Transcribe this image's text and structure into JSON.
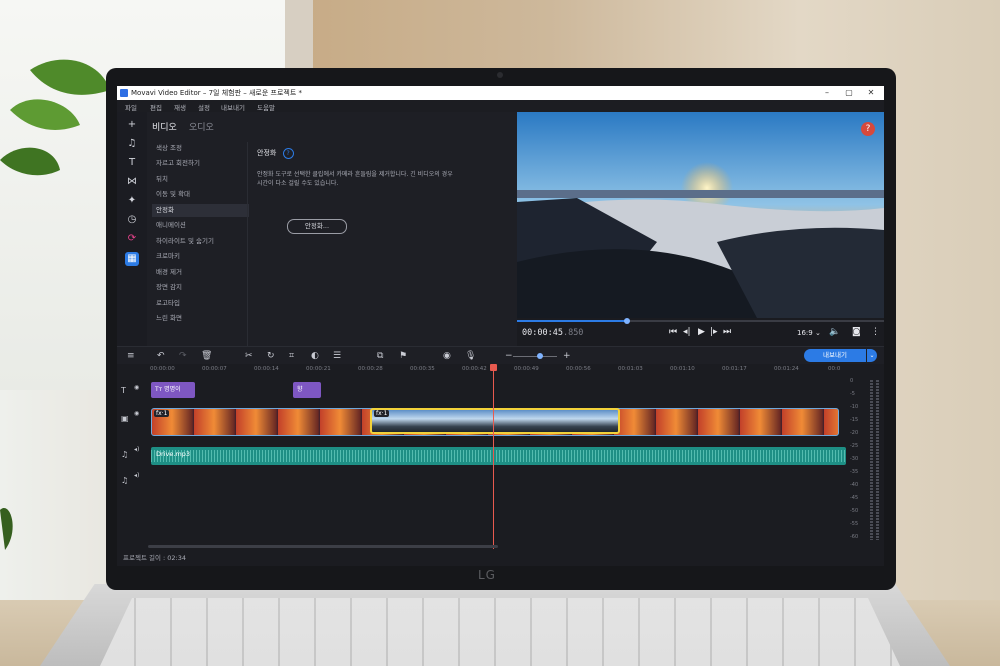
{
  "window": {
    "title": "Movavi Video Editor – 7일 체험판 – 새로운 프로젝트 *"
  },
  "menu": [
    "파일",
    "편집",
    "재생",
    "설정",
    "내보내기",
    "도움말"
  ],
  "panel_tabs": {
    "video": "비디오",
    "audio": "오디오"
  },
  "tools_list": [
    "색상 조정",
    "자르고 회전하기",
    "뒤치",
    "이동 및 확대",
    "안정화",
    "애니메이션",
    "하이라이트 및 숨기기",
    "크로마키",
    "배경 제거",
    "장면 감지",
    "로고타입",
    "느린 화면"
  ],
  "selected_tool_index": 4,
  "stabilization": {
    "heading": "안정화",
    "description_line1": "안정화 도구로 선택한 클립에서 카메라 흔들림을 제거합니다. 긴 비디오의 경우",
    "description_line2": "시간이 다소 걸릴 수도 있습니다.",
    "button": "안정화..."
  },
  "player": {
    "time": "00:00:45",
    "time_ms": ".850",
    "aspect": "16:9",
    "progress": 0.3
  },
  "toolbar": {
    "export_label": "내보내기"
  },
  "timeline": {
    "ruler": [
      "00:00:00",
      "00:00:07",
      "00:00:14",
      "00:00:21",
      "00:00:28",
      "00:00:35",
      "00:00:42",
      "00:00:49",
      "00:00:56",
      "00:01:03",
      "00:01:10",
      "00:01:17",
      "00:01:24",
      "00:0"
    ],
    "title_clip1": "Tт 명명이",
    "title_clip2": "향",
    "fx_label": "fx·1",
    "audio_clip": "Drive.mp3",
    "meter_scale": [
      "0",
      "-5",
      "-10",
      "-15",
      "-20",
      "-25",
      "-30",
      "-35",
      "-40",
      "-45",
      "-50",
      "-55",
      "-60"
    ],
    "project_length": "프로젝트 길이 : 02:34"
  },
  "laptop_brand": "LG",
  "colors": {
    "accent": "#2c7be5",
    "playhead": "#e85a4f",
    "audio": "#1e8f85",
    "title_clip": "#7e57c2"
  }
}
